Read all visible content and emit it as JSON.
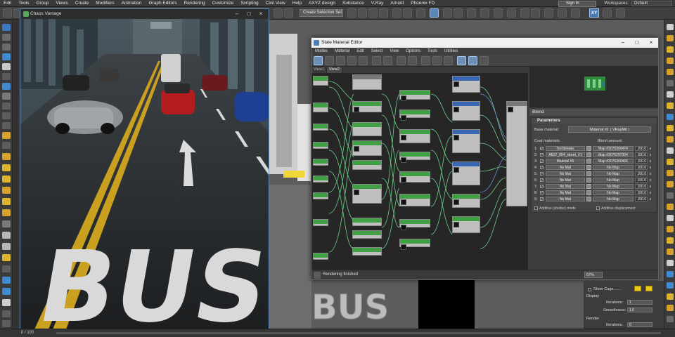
{
  "menubar": {
    "items": [
      "Edit",
      "Tools",
      "Group",
      "Views",
      "Create",
      "Modifiers",
      "Animation",
      "Graph Editors",
      "Rendering",
      "Customize",
      "Scripting",
      "Civil View",
      "Help",
      "AXYZ design",
      "Substance",
      "V-Ray",
      "Arnold",
      "Phoenix FD"
    ],
    "sign_in": "Sign In",
    "workspaces_label": "Workspaces:",
    "workspaces_value": "Default"
  },
  "toolbar": {
    "selection_set": "Create Selection Set",
    "xy_label": "XY"
  },
  "vantage": {
    "title": "Chaos Vantage"
  },
  "sme": {
    "title": "Slate Material Editor",
    "menu": [
      "Modes",
      "Material",
      "Edit",
      "Select",
      "View",
      "Options",
      "Tools",
      "Utilities"
    ],
    "tabs": [
      "View1",
      "View2"
    ],
    "active_tab": "View2",
    "status_text": "Rendering finished",
    "zoom": "67%",
    "blend_header": "Blend",
    "params_header": "Parameters",
    "base_label": "Base material:",
    "base_value": "Material #1  ( VRayMtl )",
    "coat_label": "Coat materials:",
    "blend_label": "Blend amount:",
    "coat_rows": [
      {
        "num": "1:",
        "mat": "TireStreaks",
        "map": "Map #2076300474",
        "amt": "100.0"
      },
      {
        "num": "2:",
        "mat": "AB37_004_street_V1",
        "map": "Map #2076297334",
        "amt": "100.0"
      },
      {
        "num": "3:",
        "mat": "Material #6",
        "map": "Map #2076300466",
        "amt": "100.0"
      },
      {
        "num": "4:",
        "mat": "No Mat",
        "map": "No Map",
        "amt": "100.0"
      },
      {
        "num": "5:",
        "mat": "No Mat",
        "map": "No Map",
        "amt": "100.0"
      },
      {
        "num": "6:",
        "mat": "No Mat",
        "map": "No Map",
        "amt": "100.0"
      },
      {
        "num": "7:",
        "mat": "No Mat",
        "map": "No Map",
        "amt": "100.0"
      },
      {
        "num": "8:",
        "mat": "No Mat",
        "map": "No Map",
        "amt": "100.0"
      },
      {
        "num": "9:",
        "mat": "No Mat",
        "map": "No Map",
        "amt": "100.0"
      }
    ],
    "additive_shellac": "Additive (shellac) mode",
    "additive_disp": "Additive displacement"
  },
  "cmd_panel": {
    "show_cage": "Show Cage.......",
    "display_label": "Display",
    "iterations_label": "Iterations:",
    "iterations_value": "1",
    "smoothness_label": "Smoothness:",
    "smoothness_value": "1.0",
    "render_label": "Render",
    "render_iterations_label": "Iterations:",
    "render_iterations_value": "0"
  },
  "timeline": {
    "frame": "0 / 100"
  },
  "viewport": {
    "bus_text": "BUS"
  },
  "colors": {
    "node_green": "#3fa143",
    "node_blue": "#3a66b6",
    "road_yellow": "#c9a020",
    "accent_blue": "#4b7bb3"
  }
}
